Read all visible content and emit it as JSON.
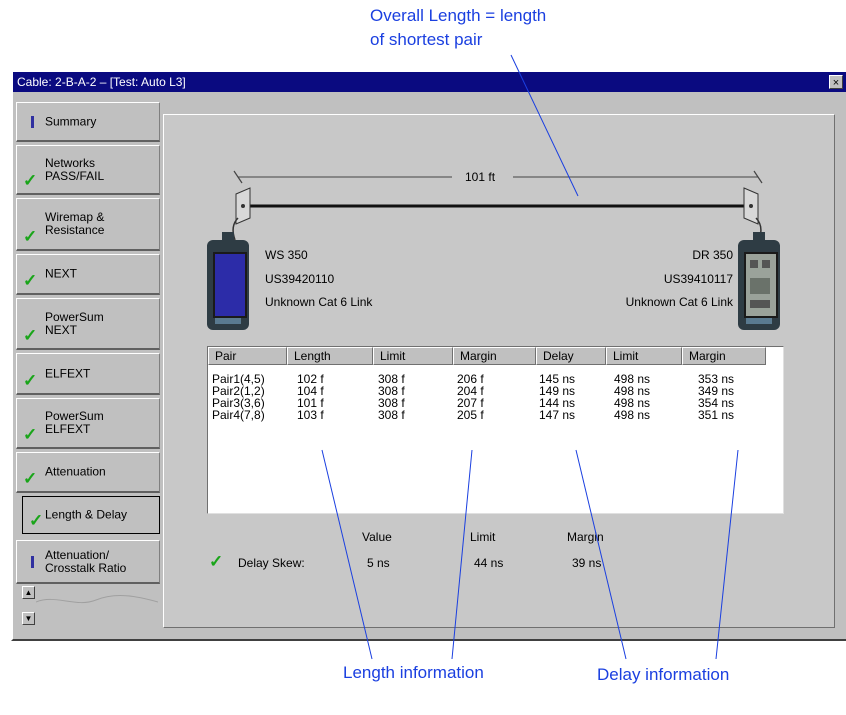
{
  "annotations": {
    "overall_length_line1": "Overall Length = length",
    "overall_length_line2": "of shortest pair",
    "length_information": "Length information",
    "delay_information": "Delay information"
  },
  "window": {
    "title": "Cable: 2-B-A-2 – [Test: Auto L3]",
    "close_glyph": "×"
  },
  "tabs": [
    {
      "label": "Summary",
      "status": "info"
    },
    {
      "label": "Networks\nPASS/FAIL",
      "status": "pass"
    },
    {
      "label": "Wiremap &\nResistance",
      "status": "pass"
    },
    {
      "label": "NEXT",
      "status": "pass"
    },
    {
      "label": "PowerSum\nNEXT",
      "status": "pass"
    },
    {
      "label": "ELFEXT",
      "status": "pass"
    },
    {
      "label": "PowerSum\nELFEXT",
      "status": "pass"
    },
    {
      "label": "Attenuation",
      "status": "pass"
    },
    {
      "label": "Length & Delay",
      "status": "pass",
      "active": true
    },
    {
      "label": "Attenuation/\nCrosstalk Ratio",
      "status": "info"
    }
  ],
  "cable": {
    "length_label": "101 ft",
    "main_unit": {
      "model": "WS 350",
      "serial": "US39420110",
      "link": "Unknown Cat 6 Link"
    },
    "remote_unit": {
      "model": "DR 350",
      "serial": "US39410117",
      "link": "Unknown Cat 6 Link"
    }
  },
  "table": {
    "headers": [
      "Pair",
      "Length",
      "Limit",
      "Margin",
      "Delay",
      "Limit",
      "Margin"
    ],
    "rows": [
      [
        "Pair1(4,5)",
        "102 f",
        "308 f",
        "206 f",
        "145 ns",
        "498 ns",
        "353 ns"
      ],
      [
        "Pair2(1,2)",
        "104 f",
        "308 f",
        "204 f",
        "149 ns",
        "498 ns",
        "349 ns"
      ],
      [
        "Pair3(3,6)",
        "101 f",
        "308 f",
        "207 f",
        "144 ns",
        "498 ns",
        "354 ns"
      ],
      [
        "Pair4(7,8)",
        "103 f",
        "308 f",
        "205 f",
        "147 ns",
        "498 ns",
        "351 ns"
      ]
    ]
  },
  "delay_skew": {
    "label": "Delay Skew:",
    "headers": {
      "value": "Value",
      "limit": "Limit",
      "margin": "Margin"
    },
    "value": "5 ns",
    "limit": "44 ns",
    "margin": "39 ns"
  },
  "colors": {
    "annotation": "#1a3fe0",
    "titlebar": "#0a0a80",
    "pass_check": "#1aa51a"
  }
}
